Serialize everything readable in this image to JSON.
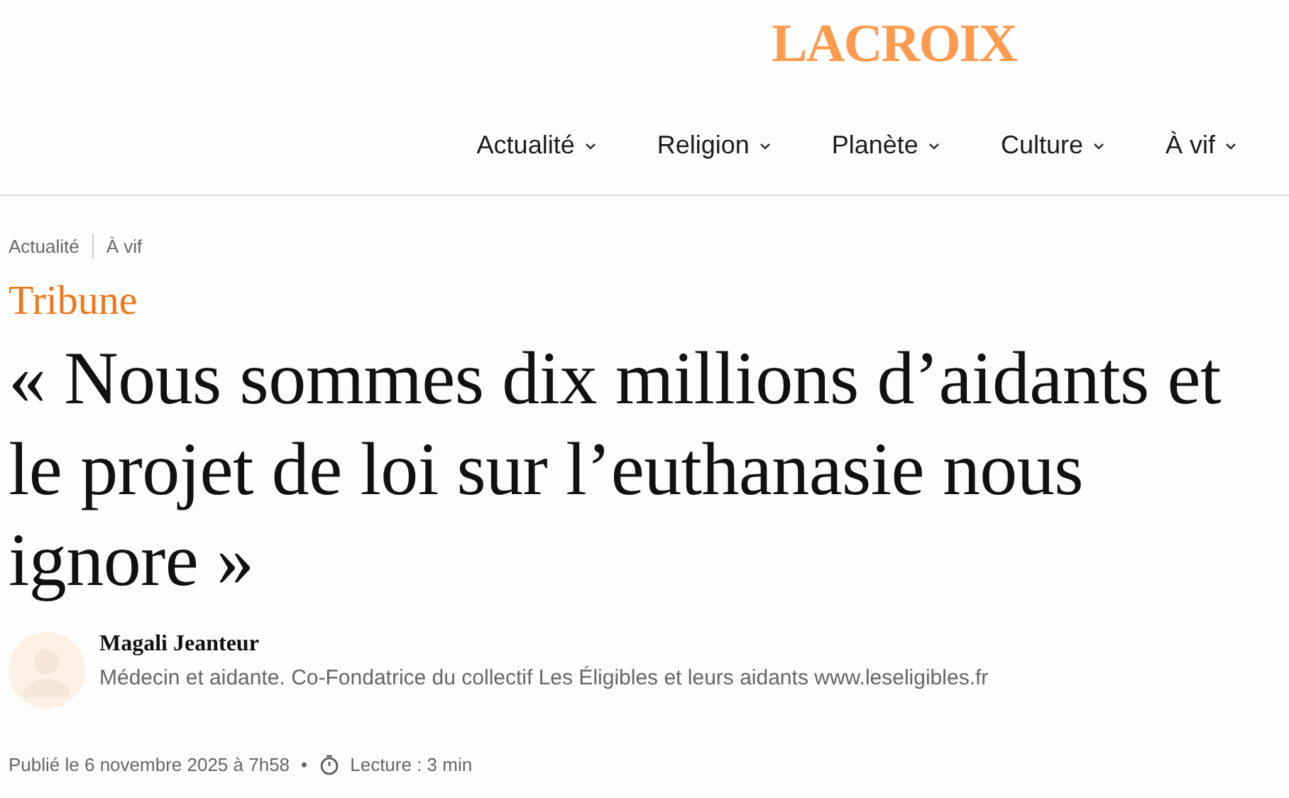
{
  "logo": {
    "prefix": "LA",
    "name": "CROIX"
  },
  "nav": [
    {
      "label": "Actualité"
    },
    {
      "label": "Religion"
    },
    {
      "label": "Planète"
    },
    {
      "label": "Culture"
    },
    {
      "label": "À vif"
    }
  ],
  "breadcrumb": [
    "Actualité",
    "À vif"
  ],
  "article": {
    "category": "Tribune",
    "title": "« Nous sommes dix millions d’aidants et le projet de loi sur l’euthanasie nous ignore »",
    "author": {
      "name": "Magali Jeanteur",
      "bio": "Médecin et aidante. Co-Fondatrice du collectif Les Éligibles et leurs aidants www.leseligibles.fr"
    },
    "published": "Publié le 6 novembre 2025 à 7h58",
    "separator": "•",
    "reading_time": "Lecture : 3 min"
  }
}
